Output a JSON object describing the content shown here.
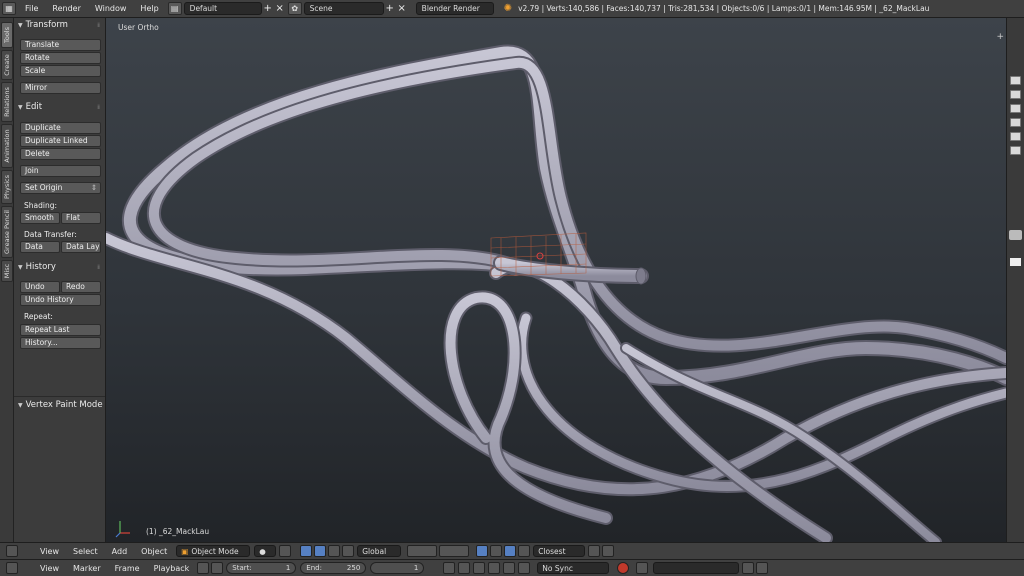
{
  "header": {
    "menus": [
      "File",
      "Render",
      "Window",
      "Help"
    ],
    "layout": "Default",
    "scene": "Scene",
    "engine": "Blender Render",
    "stats": "v2.79 | Verts:140,586 | Faces:140,737 | Tris:281,534 | Objects:0/6 | Lamps:0/1 | Mem:146.95M | _62_MackLau"
  },
  "vtabs": [
    "Tools",
    "Create",
    "Relations",
    "Animation",
    "Physics",
    "Grease Pencil",
    "Misc"
  ],
  "toolshelf": {
    "transform": {
      "title": "Transform",
      "translate": "Translate",
      "rotate": "Rotate",
      "scale": "Scale",
      "mirror": "Mirror"
    },
    "edit": {
      "title": "Edit",
      "duplicate": "Duplicate",
      "duplicate_linked": "Duplicate Linked",
      "delete": "Delete",
      "join": "Join",
      "set_origin": "Set Origin",
      "shading_label": "Shading:",
      "smooth": "Smooth",
      "flat": "Flat",
      "data_transfer_label": "Data Transfer:",
      "data": "Data",
      "data_lay": "Data Lay"
    },
    "history": {
      "title": "History",
      "undo": "Undo",
      "redo": "Redo",
      "undo_history": "Undo History",
      "repeat_label": "Repeat:",
      "repeat_last": "Repeat Last",
      "history_btn": "History..."
    },
    "vertex_paint": {
      "title": "Vertex Paint Mode"
    }
  },
  "viewport": {
    "view_label": "User Ortho",
    "object_label": "(1) _62_MackLau"
  },
  "view3d_header": {
    "menus": [
      "View",
      "Select",
      "Add",
      "Object"
    ],
    "mode": "Object Mode",
    "orientation": "Global",
    "snap": "Closest"
  },
  "timeline": {
    "menus": [
      "View",
      "Marker",
      "Frame",
      "Playback"
    ],
    "start_label": "Start:",
    "start": "1",
    "end_label": "End:",
    "end": "250",
    "current": "1",
    "sync": "No Sync"
  },
  "colors": {
    "accent": "#5680c2",
    "tube": "#a9a8b8"
  }
}
